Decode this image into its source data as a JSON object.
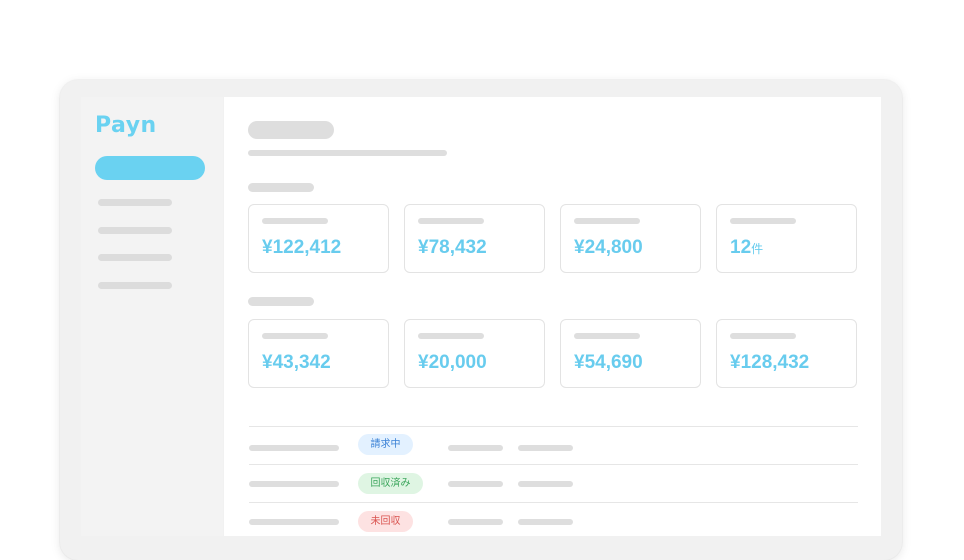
{
  "app": {
    "logo": "Payn"
  },
  "colors": {
    "brand": "#6ad2f1",
    "value_text": "#68ccee",
    "badge_billing_bg": "#e3f1ff",
    "badge_billing_text": "#3b82d6",
    "badge_collected_bg": "#dff5e3",
    "badge_collected_text": "#3aa55b",
    "badge_uncollected_bg": "#fde2e2",
    "badge_uncollected_text": "#d9534f"
  },
  "summary_row_1": [
    {
      "value": "¥122,412",
      "unit": ""
    },
    {
      "value": "¥78,432",
      "unit": ""
    },
    {
      "value": "¥24,800",
      "unit": ""
    },
    {
      "value": "12",
      "unit": "件"
    }
  ],
  "summary_row_2": [
    {
      "value": "¥43,342",
      "unit": ""
    },
    {
      "value": "¥20,000",
      "unit": ""
    },
    {
      "value": "¥54,690",
      "unit": ""
    },
    {
      "value": "¥128,432",
      "unit": ""
    }
  ],
  "rows": [
    {
      "status": "請求中"
    },
    {
      "status": "回収済み"
    },
    {
      "status": "未回収"
    }
  ]
}
